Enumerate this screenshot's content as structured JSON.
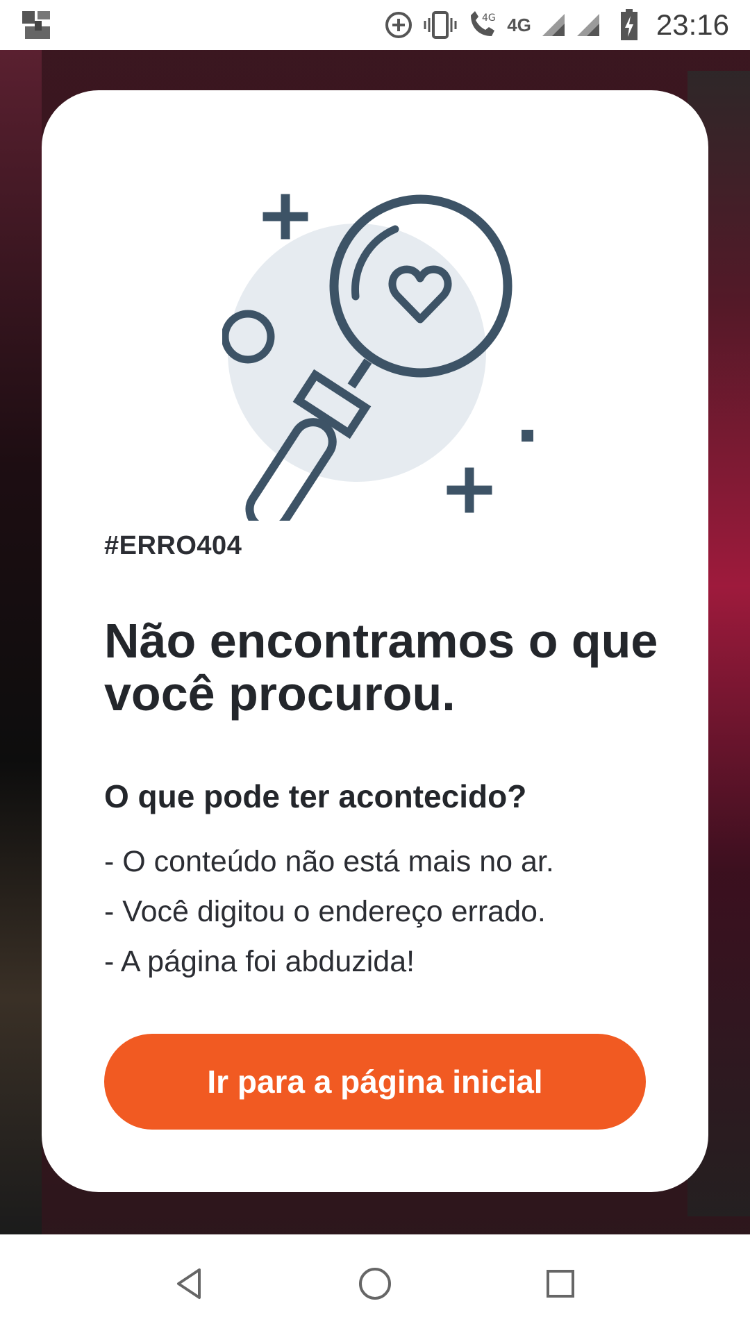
{
  "status_bar": {
    "network_label_1": "4G",
    "network_label_2": "4G",
    "time": "23:16",
    "icons": [
      "app-notification-icon",
      "data-saver-icon",
      "vibrate-icon",
      "call-4g-icon",
      "signal-icon",
      "signal-icon",
      "battery-charging-icon"
    ]
  },
  "dialog": {
    "illustration_icon": "magnifying-glass-heart-icon",
    "error_code": "#ERRO404",
    "headline": "Não encontramos o que você procurou.",
    "subheading": "O que pode ter acontecido?",
    "reasons": [
      "- O conteúdo não está mais no ar.",
      "- Você digitou o endereço errado.",
      "- A página foi abduzida!"
    ],
    "home_button_label": "Ir para a página inicial"
  },
  "nav_bar": {
    "icons": [
      "back-icon",
      "home-icon",
      "recents-icon"
    ]
  },
  "colors": {
    "accent": "#f15a22",
    "text": "#23262b",
    "illustration_stroke": "#3d5366",
    "illustration_fill": "#e6ebf0"
  }
}
